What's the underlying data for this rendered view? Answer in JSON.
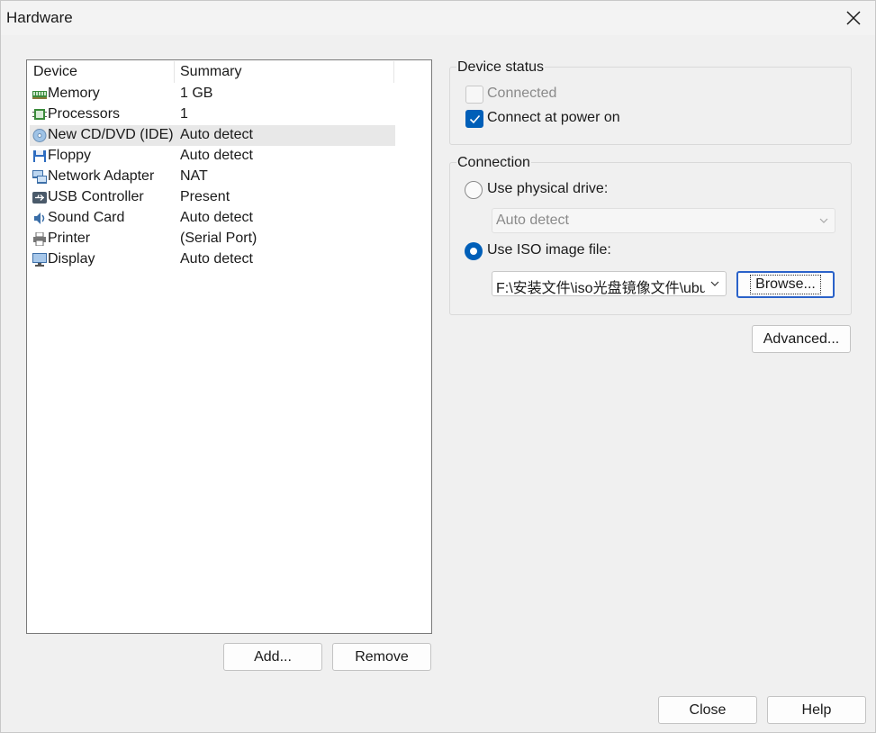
{
  "window": {
    "title": "Hardware"
  },
  "device_list": {
    "columns": [
      "Device",
      "Summary"
    ],
    "rows": [
      {
        "name": "Memory",
        "summary": "1 GB",
        "icon": "memory-icon"
      },
      {
        "name": "Processors",
        "summary": "1",
        "icon": "processor-icon"
      },
      {
        "name": "New CD/DVD (IDE)",
        "summary": "Auto detect",
        "icon": "cd-dvd-icon",
        "selected": true
      },
      {
        "name": "Floppy",
        "summary": "Auto detect",
        "icon": "floppy-icon"
      },
      {
        "name": "Network Adapter",
        "summary": "NAT",
        "icon": "network-adapter-icon"
      },
      {
        "name": "USB Controller",
        "summary": "Present",
        "icon": "usb-controller-icon"
      },
      {
        "name": "Sound Card",
        "summary": "Auto detect",
        "icon": "sound-card-icon"
      },
      {
        "name": "Printer",
        "summary": "(Serial Port)",
        "icon": "printer-icon"
      },
      {
        "name": "Display",
        "summary": "Auto detect",
        "icon": "display-icon"
      }
    ]
  },
  "buttons": {
    "add": "Add...",
    "remove": "Remove",
    "browse": "Browse...",
    "advanced": "Advanced...",
    "close": "Close",
    "help": "Help"
  },
  "device_status": {
    "label": "Device status",
    "connected": {
      "label": "Connected",
      "checked": false,
      "disabled": true
    },
    "connect_at_power_on": {
      "label": "Connect at power on",
      "checked": true
    }
  },
  "connection": {
    "label": "Connection",
    "use_physical_drive": {
      "label": "Use physical drive:",
      "selected": false
    },
    "physical_drive_value": "Auto detect",
    "use_iso_image": {
      "label": "Use ISO image file:",
      "selected": true
    },
    "iso_path": "F:\\安装文件\\iso光盘镜像文件\\ubuntu"
  },
  "colors": {
    "accent": "#005fb8",
    "selection": "#e8e8e8",
    "focus_border": "#2a62c9"
  }
}
